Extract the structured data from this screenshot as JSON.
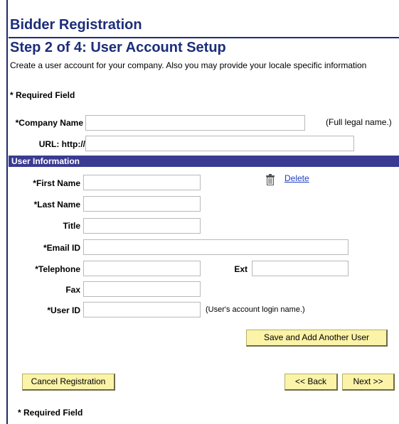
{
  "page": {
    "title": "Bidder Registration",
    "step_title": "Step 2 of 4: User Account Setup",
    "instructions": "Create a user account for your company.  Also you may provide your locale specific information",
    "required_note": "* Required Field"
  },
  "company": {
    "name_label": "*Company Name",
    "name_value": "",
    "name_hint": "(Full legal name.)",
    "url_label": "URL:  http://",
    "url_value": ""
  },
  "user_section": {
    "header": "User Information",
    "delete_label": "Delete",
    "delete_icon": "trash-icon",
    "first_name_label": "*First Name",
    "last_name_label": "*Last Name",
    "title_label": "Title",
    "email_label": "*Email ID",
    "telephone_label": "*Telephone",
    "ext_label": "Ext",
    "fax_label": "Fax",
    "user_id_label": "*User ID",
    "user_id_hint": "(User's account login name.)",
    "first_name_value": "",
    "last_name_value": "",
    "title_value": "",
    "email_value": "",
    "telephone_value": "",
    "ext_value": "",
    "fax_value": "",
    "user_id_value": ""
  },
  "buttons": {
    "save_add_user": "Save and Add Another User",
    "cancel": "Cancel Registration",
    "back": "<< Back",
    "next": "Next >>"
  },
  "colors": {
    "heading": "#1c2d7a",
    "section_bar": "#3a3a93",
    "button_bg": "#fbf3a8",
    "link": "#1f3fbf"
  }
}
